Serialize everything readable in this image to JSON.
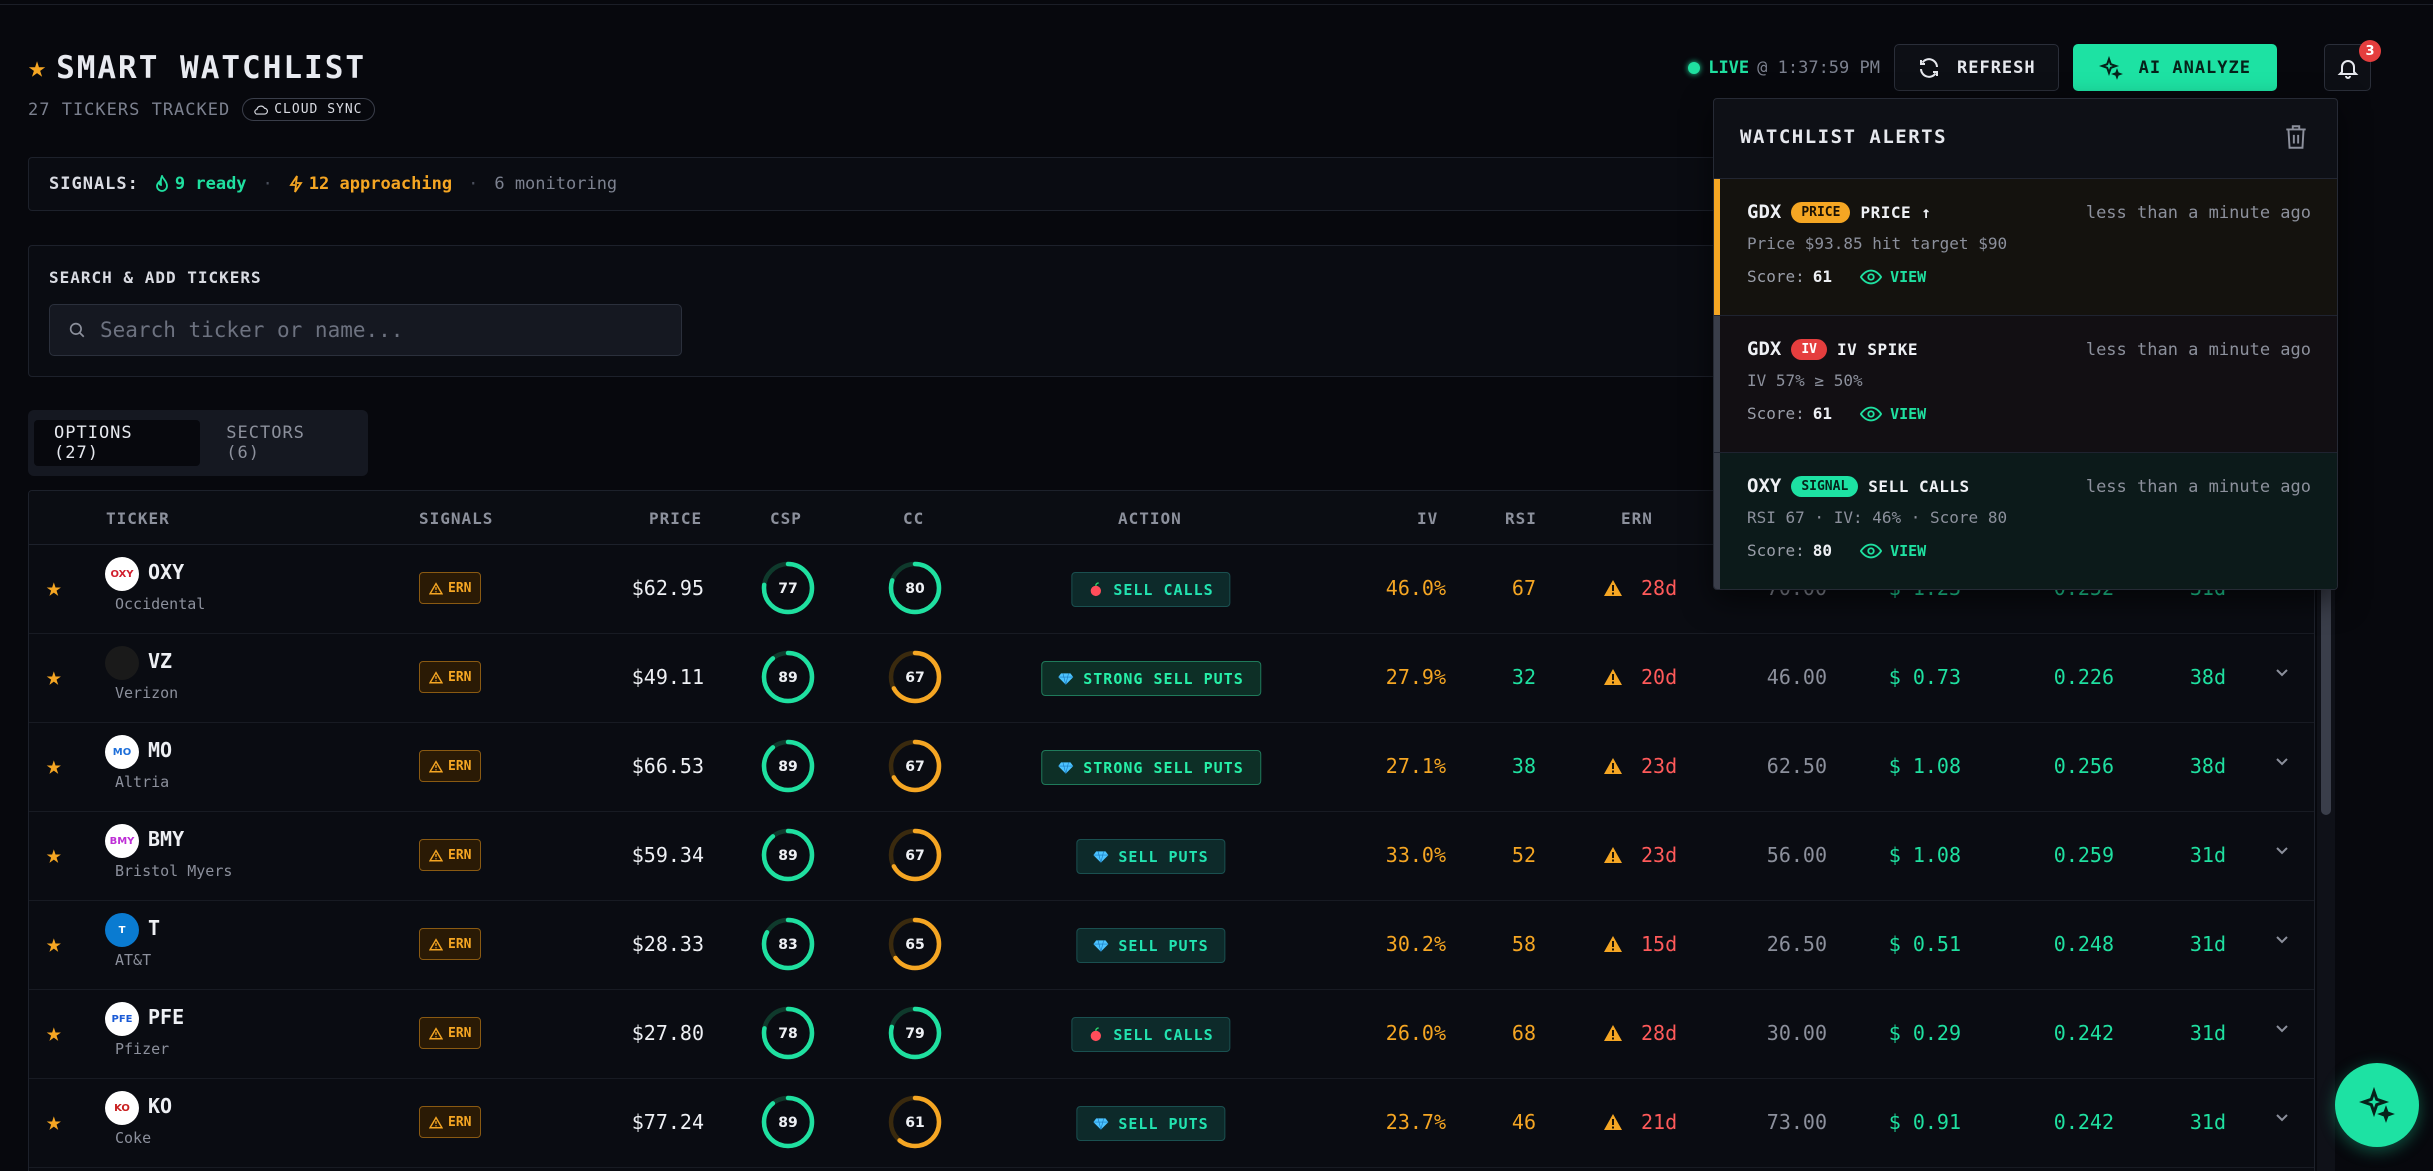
{
  "header": {
    "title": "SMART WATCHLIST",
    "subtitle": "27 TICKERS TRACKED",
    "cloud_badge": "CLOUD SYNC",
    "live_label": "LIVE",
    "live_time": "@ 1:37:59 PM",
    "refresh_label": "REFRESH",
    "ai_label": "AI ANALYZE",
    "notification_count": "3"
  },
  "signals": {
    "label": "SIGNALS:",
    "ready": "9 ready",
    "approaching": "12 approaching",
    "monitoring": "6 monitoring",
    "separator": "·"
  },
  "search": {
    "label": "SEARCH & ADD TICKERS",
    "placeholder": "Search ticker or name..."
  },
  "tabs": [
    {
      "label": "OPTIONS (27)",
      "active": true
    },
    {
      "label": "SECTORS (6)",
      "active": false
    }
  ],
  "table": {
    "columns": {
      "ticker": "TICKER",
      "signals": "SIGNALS",
      "price": "PRICE",
      "csp": "CSP",
      "cc": "CC",
      "action": "ACTION",
      "iv": "IV",
      "rsi": "RSI",
      "ern": "ERN"
    },
    "ern_badge": "ERN",
    "rows": [
      {
        "symbol": "OXY",
        "name": "Occidental",
        "logo": "OXY",
        "logo_bg": "#ffffff",
        "logo_fg": "#d11f2e",
        "price": "$62.95",
        "csp": 77,
        "cc": 80,
        "action": "SELL CALLS",
        "action_icon": "apple",
        "strong": false,
        "iv": "46.0%",
        "rsi": "67",
        "rsi_color": "#f5a623",
        "ern": "28d",
        "strike": "70.00",
        "premium": "$ 1.23",
        "delta": "0.252",
        "dte": "31d"
      },
      {
        "symbol": "VZ",
        "name": "Verizon",
        "logo": "",
        "logo_bg": "#1a1a1a",
        "logo_fg": "#ffffff",
        "price": "$49.11",
        "csp": 89,
        "cc": 67,
        "action": "STRONG SELL PUTS",
        "action_icon": "diamond",
        "strong": true,
        "iv": "27.9%",
        "rsi": "32",
        "rsi_color": "#1fe0a0",
        "ern": "20d",
        "strike": "46.00",
        "premium": "$ 0.73",
        "delta": "0.226",
        "dte": "38d"
      },
      {
        "symbol": "MO",
        "name": "Altria",
        "logo": "MO",
        "logo_bg": "#ffffff",
        "logo_fg": "#1e6fd9",
        "price": "$66.53",
        "csp": 89,
        "cc": 67,
        "action": "STRONG SELL PUTS",
        "action_icon": "diamond",
        "strong": true,
        "iv": "27.1%",
        "rsi": "38",
        "rsi_color": "#1fe0a0",
        "ern": "23d",
        "strike": "62.50",
        "premium": "$ 1.08",
        "delta": "0.256",
        "dte": "38d"
      },
      {
        "symbol": "BMY",
        "name": "Bristol Myers",
        "logo": "BMY",
        "logo_bg": "#ffffff",
        "logo_fg": "#be2ed6",
        "price": "$59.34",
        "csp": 89,
        "cc": 67,
        "action": "SELL PUTS",
        "action_icon": "diamond",
        "strong": false,
        "iv": "33.0%",
        "rsi": "52",
        "rsi_color": "#f5a623",
        "ern": "23d",
        "strike": "56.00",
        "premium": "$ 1.08",
        "delta": "0.259",
        "dte": "31d"
      },
      {
        "symbol": "T",
        "name": "AT&T",
        "logo": "T",
        "logo_bg": "#0a7bd1",
        "logo_fg": "#ffffff",
        "price": "$28.33",
        "csp": 83,
        "cc": 65,
        "action": "SELL PUTS",
        "action_icon": "diamond",
        "strong": false,
        "iv": "30.2%",
        "rsi": "58",
        "rsi_color": "#f5a623",
        "ern": "15d",
        "strike": "26.50",
        "premium": "$ 0.51",
        "delta": "0.248",
        "dte": "31d"
      },
      {
        "symbol": "PFE",
        "name": "Pfizer",
        "logo": "PFE",
        "logo_bg": "#ffffff",
        "logo_fg": "#1b5bd6",
        "price": "$27.80",
        "csp": 78,
        "cc": 79,
        "action": "SELL CALLS",
        "action_icon": "apple",
        "strong": false,
        "iv": "26.0%",
        "rsi": "68",
        "rsi_color": "#f5a623",
        "ern": "28d",
        "strike": "30.00",
        "premium": "$ 0.29",
        "delta": "0.242",
        "dte": "31d"
      },
      {
        "symbol": "KO",
        "name": "Coke",
        "logo": "KO",
        "logo_bg": "#ffffff",
        "logo_fg": "#c81e1e",
        "price": "$77.24",
        "csp": 89,
        "cc": 61,
        "action": "SELL PUTS",
        "action_icon": "diamond",
        "strong": false,
        "iv": "23.7%",
        "rsi": "46",
        "rsi_color": "#f5a623",
        "ern": "21d",
        "strike": "73.00",
        "premium": "$ 0.91",
        "delta": "0.242",
        "dte": "31d"
      }
    ]
  },
  "alerts": {
    "title": "WATCHLIST ALERTS",
    "score_label": "Score:",
    "view_label": "VIEW",
    "items": [
      {
        "symbol": "GDX",
        "tag": "PRICE",
        "tag_bg": "#f5a623",
        "tag_fg": "#1a1205",
        "type": "PRICE ↑",
        "time": "less than a minute ago",
        "desc": "Price $93.85 hit target $90",
        "score": "61",
        "bar": "#f5a623",
        "bg": "#14120e"
      },
      {
        "symbol": "GDX",
        "tag": "IV",
        "tag_bg": "#e53e3e",
        "tag_fg": "#ffffff",
        "type": "IV SPIKE",
        "time": "less than a minute ago",
        "desc": "IV 57% ≥ 50%",
        "score": "61",
        "bar": "#3a3e4a",
        "bg": "#120f13"
      },
      {
        "symbol": "OXY",
        "tag": "SIGNAL",
        "tag_bg": "#1de2a3",
        "tag_fg": "#06221a",
        "type": "SELL CALLS",
        "time": "less than a minute ago",
        "desc": "RSI 67 · IV: 46% · Score 80",
        "score": "80",
        "bar": "#3a3e4a",
        "bg": "#0c1a1a"
      }
    ]
  },
  "colors": {
    "accent": "#1de2a3",
    "warning": "#f5a623",
    "danger": "#ff5a5a"
  }
}
